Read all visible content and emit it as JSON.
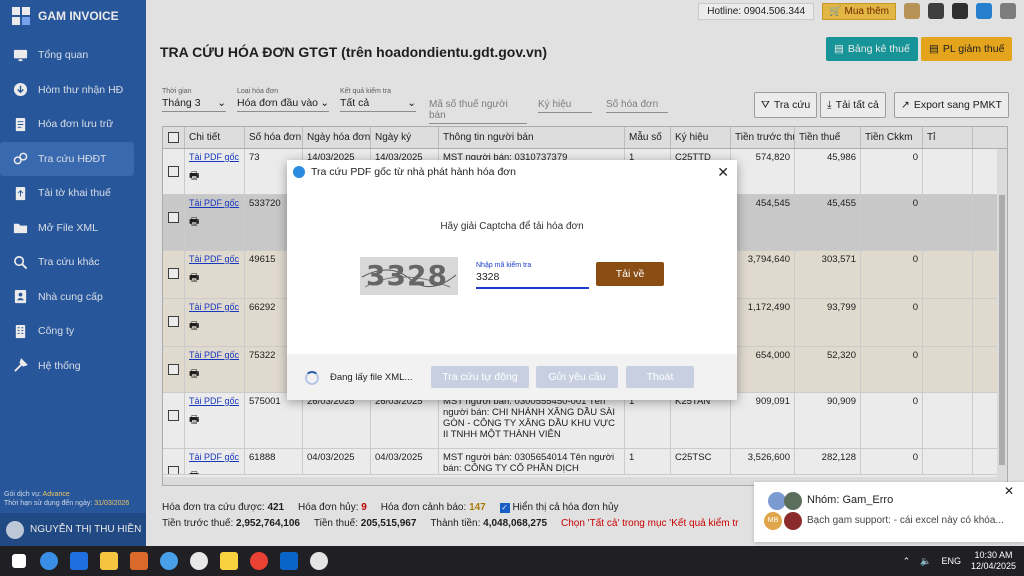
{
  "app": {
    "name": "GAM INVOICE"
  },
  "sidebar": {
    "items": [
      {
        "label": "Tổng quan",
        "icon": "monitor-icon"
      },
      {
        "label": "Hòm thư nhận HĐ",
        "icon": "download-icon"
      },
      {
        "label": "Hóa đơn lưu trữ",
        "icon": "document-icon"
      },
      {
        "label": "Tra cứu HĐĐT",
        "icon": "link-icon"
      },
      {
        "label": "Tải tờ khai thuế",
        "icon": "upload-document-icon"
      },
      {
        "label": "Mở File XML",
        "icon": "folder-icon"
      },
      {
        "label": "Tra cứu khác",
        "icon": "search-icon"
      },
      {
        "label": "Nhà cung cấp",
        "icon": "contacts-icon"
      },
      {
        "label": "Công ty",
        "icon": "building-icon"
      },
      {
        "label": "Hệ thống",
        "icon": "tools-icon"
      }
    ],
    "service_label": "Gói dịch vụ:",
    "service_value": "Advance",
    "expiry_label": "Thời hạn sử dụng đến ngày:",
    "expiry_value": "31/03/2026",
    "user_name": "NGUYỄN THỊ THU HIỀN"
  },
  "topbar": {
    "hotline": "Hotline: 0904.506.344",
    "buy_label": "Mua thêm"
  },
  "page": {
    "title": "TRA CỨU HÓA ĐƠN GTGT (trên hoadondientu.gdt.gov.vn)",
    "btn_bangke": "Bảng kê thuế",
    "btn_pl": "PL giảm thuế"
  },
  "filters": {
    "period_label": "Thời gian",
    "period_value": "Tháng 3",
    "type_label": "Loại hóa đơn",
    "type_value": "Hóa đơn đầu vào",
    "result_label": "Kết quả kiểm tra",
    "result_value": "Tất cả",
    "mst_placeholder": "Mã số thuế người bán",
    "symbol_placeholder": "Ký hiệu",
    "number_placeholder": "Số hóa đơn",
    "btn_search": "Tra cứu",
    "btn_download_all": "Tải tất cả",
    "btn_export": "Export sang PMKT"
  },
  "table": {
    "columns": [
      "Chi tiết",
      "Số hóa đơn",
      "Ngày hóa đơn",
      "Ngày ký",
      "Thông tin người bán",
      "Mẫu số",
      "Ký hiệu",
      "Tiền trước thuế",
      "Tiền thuế",
      "Tiền Ckkm",
      "Tỉ"
    ],
    "rows": [
      {
        "link": "Tải PDF gốc",
        "number": "73",
        "date": "14/03/2025",
        "sign": "14/03/2025",
        "seller": "MST người bán: 0310737379",
        "form": "1",
        "symbol": "C25TTD",
        "pre_tax": "574,820",
        "tax": "45,986",
        "ckkm": "0"
      },
      {
        "link": "Tải PDF gốc",
        "number": "533720",
        "date": "",
        "sign": "",
        "seller": "",
        "form": "",
        "symbol": "",
        "pre_tax": "454,545",
        "tax": "45,455",
        "ckkm": "0"
      },
      {
        "link": "Tải PDF gốc",
        "number": "49615",
        "date": "",
        "sign": "",
        "seller": "",
        "form": "",
        "symbol": "",
        "pre_tax": "3,794,640",
        "tax": "303,571",
        "ckkm": "0"
      },
      {
        "link": "Tải PDF gốc",
        "number": "66292",
        "date": "",
        "sign": "",
        "seller": "",
        "form": "",
        "symbol": "",
        "pre_tax": "1,172,490",
        "tax": "93,799",
        "ckkm": "0"
      },
      {
        "link": "Tải PDF gốc",
        "number": "75322",
        "date": "",
        "sign": "",
        "seller": "",
        "form": "",
        "symbol": "",
        "pre_tax": "654,000",
        "tax": "52,320",
        "ckkm": "0"
      },
      {
        "link": "Tải PDF gốc",
        "number": "575001",
        "date": "26/03/2025",
        "sign": "26/03/2025",
        "seller": "MST người bán: 0300555450-001 Tên người bán: CHI NHÁNH XĂNG DẦU SÀI GÒN - CÔNG TY XĂNG DẦU KHU VỰC II TNHH MỘT THÀNH VIÊN",
        "form": "1",
        "symbol": "K25TAN",
        "pre_tax": "909,091",
        "tax": "90,909",
        "ckkm": "0"
      },
      {
        "link": "Tải PDF gốc",
        "number": "61888",
        "date": "04/03/2025",
        "sign": "04/03/2025",
        "seller": "MST người bán: 0305654014 Tên người bán: CÔNG TY CỔ PHẦN DỊCH",
        "form": "1",
        "symbol": "C25TSC",
        "pre_tax": "3,526,600",
        "tax": "282,128",
        "ckkm": "0"
      }
    ]
  },
  "stats": {
    "found_label": "Hóa đơn tra cứu được:",
    "found_value": "421",
    "cancel_label": "Hóa đơn hủy:",
    "cancel_value": "9",
    "warn_label": "Hóa đơn cảnh báo:",
    "warn_value": "147",
    "show_cancel_label": "Hiển thị cả hóa đơn hủy",
    "pretax_label": "Tiền trước thuế:",
    "pretax_value": "2,952,764,106",
    "tax_label": "Tiền thuế:",
    "tax_value": "205,515,967",
    "total_label": "Thành tiền:",
    "total_value": "4,048,068,275",
    "hint": "Chọn 'Tất cả' trong mục 'Kết quả kiểm tr"
  },
  "modal": {
    "title": "Tra cứu PDF gốc từ nhà phát hành hóa đơn",
    "prompt": "Hãy giải Captcha để tải hóa đơn",
    "captcha_text": "3328",
    "input_label": "Nhập mã kiểm tra",
    "input_value": "3328",
    "btn_download": "Tải về",
    "status": "Đang lấy file XML...",
    "btn_auto": "Tra cứu tự động",
    "btn_request": "Gửi yêu cầu",
    "btn_exit": "Thoát"
  },
  "chat": {
    "title": "Nhóm: Gam_Erro",
    "message": "Bạch gam support: - cái excel này có khóa..."
  },
  "taskbar": {
    "lang": "ENG",
    "time": "10:30 AM",
    "date": "12/04/2025"
  }
}
